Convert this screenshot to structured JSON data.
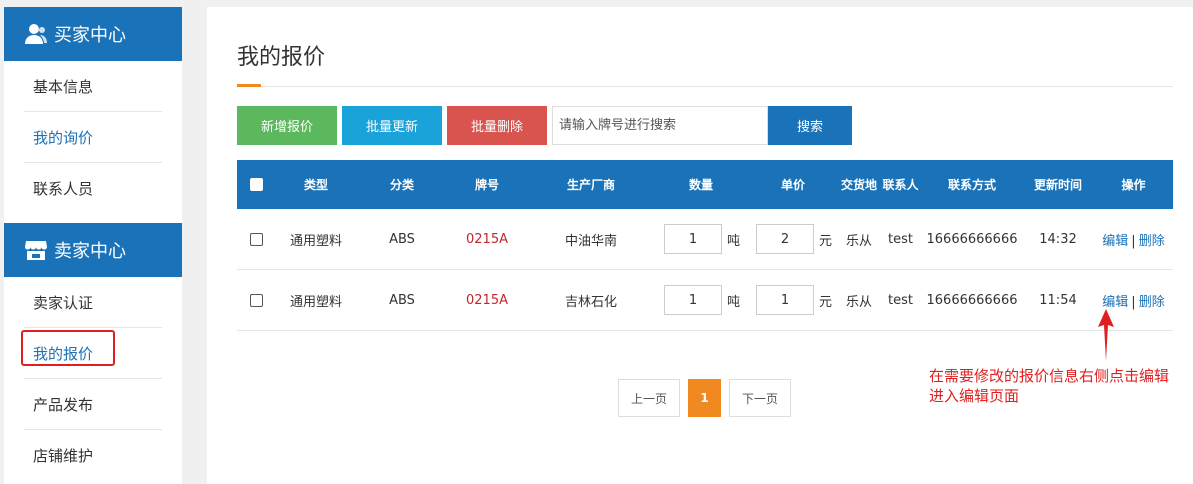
{
  "sidebar": {
    "buyer_title": "买家中心",
    "buyer_items": [
      "基本信息",
      "我的询价",
      "联系人员"
    ],
    "seller_title": "卖家中心",
    "seller_items": [
      "卖家认证",
      "我的报价",
      "产品发布",
      "店铺维护"
    ]
  },
  "main": {
    "title": "我的报价",
    "toolbar": {
      "add_label": "新增报价",
      "batch_update_label": "批量更新",
      "batch_delete_label": "批量删除",
      "search_placeholder": "请输入牌号进行搜索",
      "search_label": "搜索"
    },
    "table": {
      "headers": [
        "类型",
        "分类",
        "牌号",
        "生产厂商",
        "数量",
        "单价",
        "交货地",
        "联系人",
        "联系方式",
        "更新时间",
        "操作"
      ],
      "rows": [
        {
          "type": "通用塑料",
          "category": "ABS",
          "grade": "0215A",
          "maker": "中油华南",
          "qty": "1",
          "qty_unit": "吨",
          "price": "2",
          "price_unit": "元",
          "place": "乐从",
          "contact": "test",
          "phone": "16666666666",
          "time": "14:32",
          "edit": "编辑",
          "sep": "|",
          "delete": "删除"
        },
        {
          "type": "通用塑料",
          "category": "ABS",
          "grade": "0215A",
          "maker": "吉林石化",
          "qty": "1",
          "qty_unit": "吨",
          "price": "1",
          "price_unit": "元",
          "place": "乐从",
          "contact": "test",
          "phone": "16666666666",
          "time": "11:54",
          "edit": "编辑",
          "sep": "|",
          "delete": "删除"
        }
      ]
    },
    "pager": {
      "prev": "上一页",
      "current": "1",
      "next": "下一页"
    }
  },
  "annotation": {
    "line1": "在需要修改的报价信息右侧点击编辑",
    "line2": "进入编辑页面"
  },
  "colors": {
    "primary": "#1a72b8",
    "accent": "#f08a20",
    "green": "#5cb85c",
    "cyan": "#1aa3d9",
    "red": "#d9534f",
    "annotation": "#e02020"
  }
}
